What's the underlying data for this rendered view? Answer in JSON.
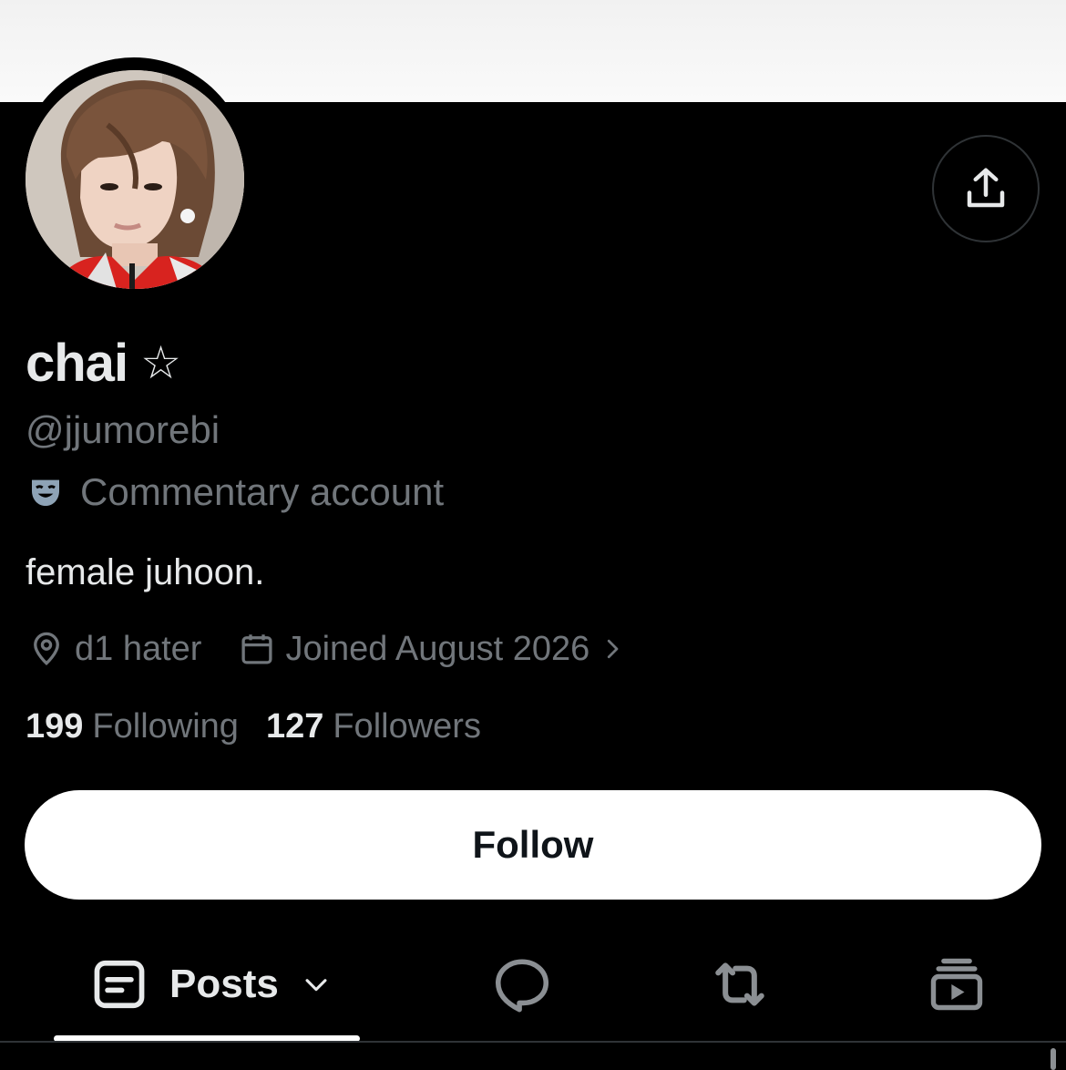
{
  "profile": {
    "display_name": "chai",
    "name_symbol": "☆",
    "handle": "@jjumorebi",
    "label": "Commentary account",
    "bio": "female juhoon.",
    "location": "d1 hater",
    "joined": "Joined August 2026"
  },
  "stats": {
    "following_count": "199",
    "following_label": "Following",
    "followers_count": "127",
    "followers_label": "Followers"
  },
  "actions": {
    "follow_label": "Follow"
  },
  "tabs": {
    "posts_label": "Posts"
  },
  "icons": {
    "share": "share-upload-icon",
    "label": "theater-mask-icon",
    "location": "location-pin-icon",
    "joined": "calendar-icon",
    "chevron": "chevron-right-icon",
    "posts": "article-icon",
    "dropdown": "chevron-down-icon",
    "replies": "speech-bubble-icon",
    "reposts": "repost-icon",
    "media": "video-stack-icon"
  },
  "colors": {
    "background": "#000000",
    "primary_text": "#e7e9ea",
    "secondary_text": "#71767b",
    "border": "#2f3336",
    "follow_bg": "#ffffff",
    "follow_text": "#0f1419"
  }
}
